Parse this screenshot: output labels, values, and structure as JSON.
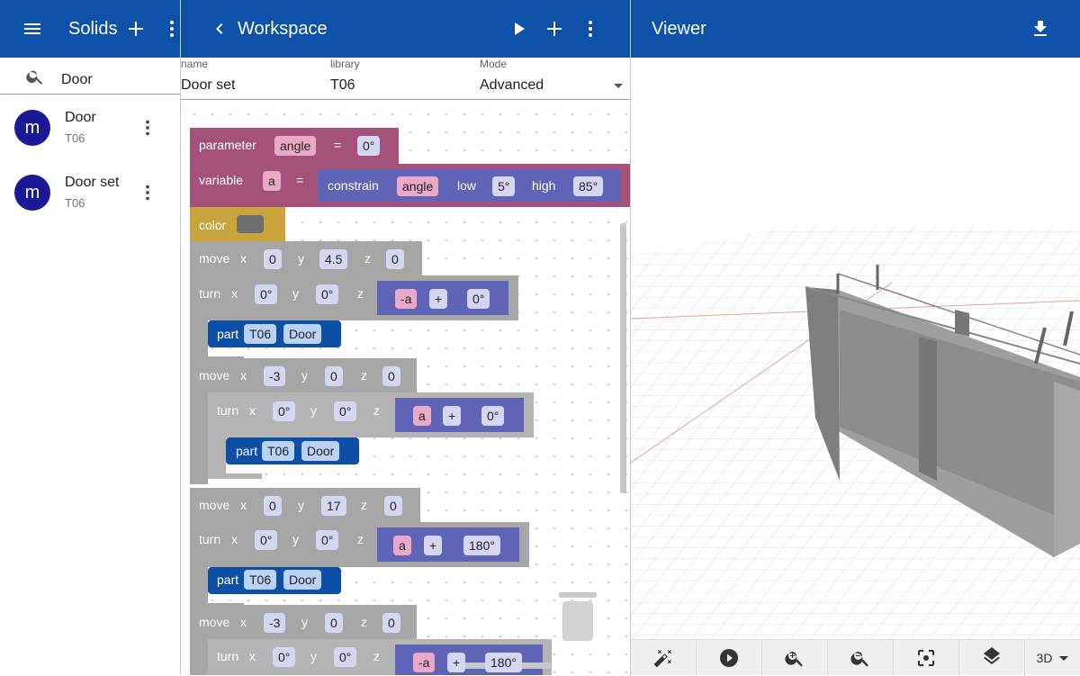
{
  "solids_panel": {
    "title": "Solids",
    "search_value": "Door",
    "items": [
      {
        "avatar": "m",
        "title": "Door",
        "subtitle": "T06"
      },
      {
        "avatar": "m",
        "title": "Door set",
        "subtitle": "T06"
      }
    ]
  },
  "workspace": {
    "title": "Workspace",
    "fields": {
      "name_label": "name",
      "name_value": "Door set",
      "library_label": "library",
      "library_value": "T06",
      "mode_label": "Mode",
      "mode_value": "Advanced"
    }
  },
  "blocks": {
    "parameter": {
      "label": "parameter",
      "name": "angle",
      "eq": "=",
      "value": "0°"
    },
    "variable": {
      "label": "variable",
      "name": "a",
      "eq": "=",
      "fn": "constrain",
      "arg": "angle",
      "low_label": "low",
      "low": "5°",
      "high_label": "high",
      "high": "85°"
    },
    "color": {
      "label": "color"
    },
    "move1": {
      "label": "move",
      "x": "0",
      "y": "4.5",
      "z": "0"
    },
    "turn1": {
      "label": "turn",
      "x": "0°",
      "y": "0°",
      "var": "-a",
      "op": "+",
      "val": "0°"
    },
    "part1": {
      "label": "part",
      "lib": "T06",
      "name": "Door"
    },
    "move2": {
      "label": "move",
      "x": "-3",
      "y": "0",
      "z": "0"
    },
    "turn2": {
      "label": "turn",
      "x": "0°",
      "y": "0°",
      "var": "a",
      "op": "+",
      "val": "0°"
    },
    "part2": {
      "label": "part",
      "lib": "T06",
      "name": "Door"
    },
    "move3": {
      "label": "move",
      "x": "0",
      "y": "17",
      "z": "0"
    },
    "turn3": {
      "label": "turn",
      "x": "0°",
      "y": "0°",
      "var": "a",
      "op": "+",
      "val": "180°"
    },
    "part3": {
      "label": "part",
      "lib": "T06",
      "name": "Door"
    },
    "move4": {
      "label": "move",
      "x": "-3",
      "y": "0",
      "z": "0"
    },
    "turn4": {
      "label": "turn",
      "x": "0°",
      "y": "0°",
      "var": "-a",
      "op": "+",
      "val": "180°"
    },
    "axis": {
      "x": "x",
      "y": "y",
      "z": "z"
    }
  },
  "viewer": {
    "title": "Viewer",
    "view_mode": "3D"
  },
  "colors": {
    "header": "#0d52a8",
    "avatar": "#1a1896",
    "parameter": "#a5527a",
    "color_block": "#c9a33c",
    "move": "#a6a6a6",
    "value": "#6064b7",
    "part": "#0e4fa6"
  }
}
